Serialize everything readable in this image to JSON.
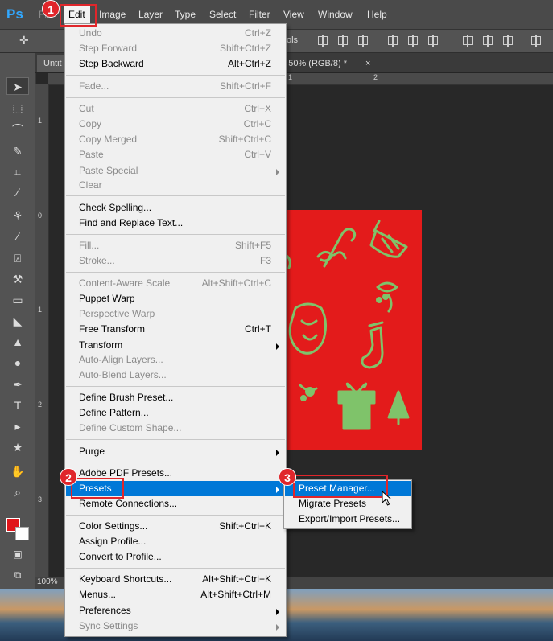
{
  "app": {
    "logo": "Ps"
  },
  "menubar": {
    "items": [
      "File",
      "Edit",
      "Image",
      "Layer",
      "Type",
      "Select",
      "Filter",
      "View",
      "Window",
      "Help"
    ],
    "active": "Edit"
  },
  "options": {
    "partial_label": "ols"
  },
  "document": {
    "tab_label": "Untit",
    "tab2_label": "@ 50% (RGB/8) *",
    "tab_close": "×",
    "zoom": "100%",
    "ruler_top": [
      "1",
      "2"
    ],
    "ruler_left": [
      "1",
      "0",
      "1",
      "2",
      "3"
    ]
  },
  "edit_menu": {
    "items": [
      {
        "label": "Undo",
        "shortcut": "Ctrl+Z",
        "disabled": true
      },
      {
        "label": "Step Forward",
        "shortcut": "Shift+Ctrl+Z",
        "disabled": true
      },
      {
        "label": "Step Backward",
        "shortcut": "Alt+Ctrl+Z",
        "disabled": false
      },
      {
        "label": "Fade...",
        "shortcut": "Shift+Ctrl+F",
        "disabled": true
      },
      {
        "label": "Cut",
        "shortcut": "Ctrl+X",
        "disabled": true
      },
      {
        "label": "Copy",
        "shortcut": "Ctrl+C",
        "disabled": true
      },
      {
        "label": "Copy Merged",
        "shortcut": "Shift+Ctrl+C",
        "disabled": true
      },
      {
        "label": "Paste",
        "shortcut": "Ctrl+V",
        "disabled": true
      },
      {
        "label": "Paste Special",
        "shortcut": "",
        "disabled": true,
        "submenu": true
      },
      {
        "label": "Clear",
        "shortcut": "",
        "disabled": true
      },
      {
        "label": "Check Spelling...",
        "shortcut": "",
        "disabled": false
      },
      {
        "label": "Find and Replace Text...",
        "shortcut": "",
        "disabled": false
      },
      {
        "label": "Fill...",
        "shortcut": "Shift+F5",
        "disabled": true
      },
      {
        "label": "Stroke...",
        "shortcut": "F3",
        "disabled": true
      },
      {
        "label": "Content-Aware Scale",
        "shortcut": "Alt+Shift+Ctrl+C",
        "disabled": true
      },
      {
        "label": "Puppet Warp",
        "shortcut": "",
        "disabled": false
      },
      {
        "label": "Perspective Warp",
        "shortcut": "",
        "disabled": true
      },
      {
        "label": "Free Transform",
        "shortcut": "Ctrl+T",
        "disabled": false
      },
      {
        "label": "Transform",
        "shortcut": "",
        "disabled": false,
        "submenu": true
      },
      {
        "label": "Auto-Align Layers...",
        "shortcut": "",
        "disabled": true
      },
      {
        "label": "Auto-Blend Layers...",
        "shortcut": "",
        "disabled": true
      },
      {
        "label": "Define Brush Preset...",
        "shortcut": "",
        "disabled": false
      },
      {
        "label": "Define Pattern...",
        "shortcut": "",
        "disabled": false
      },
      {
        "label": "Define Custom Shape...",
        "shortcut": "",
        "disabled": true
      },
      {
        "label": "Purge",
        "shortcut": "",
        "disabled": false,
        "submenu": true
      },
      {
        "label": "Adobe PDF Presets...",
        "shortcut": "",
        "disabled": false
      },
      {
        "label": "Presets",
        "shortcut": "",
        "disabled": false,
        "submenu": true,
        "highlighted": true
      },
      {
        "label": "Remote Connections...",
        "shortcut": "",
        "disabled": false
      },
      {
        "label": "Color Settings...",
        "shortcut": "Shift+Ctrl+K",
        "disabled": false
      },
      {
        "label": "Assign Profile...",
        "shortcut": "",
        "disabled": false
      },
      {
        "label": "Convert to Profile...",
        "shortcut": "",
        "disabled": false
      },
      {
        "label": "Keyboard Shortcuts...",
        "shortcut": "Alt+Shift+Ctrl+K",
        "disabled": false
      },
      {
        "label": "Menus...",
        "shortcut": "Alt+Shift+Ctrl+M",
        "disabled": false
      },
      {
        "label": "Preferences",
        "shortcut": "",
        "disabled": false,
        "submenu": true
      },
      {
        "label": "Sync Settings",
        "shortcut": "",
        "disabled": true,
        "submenu": true
      }
    ]
  },
  "presets_submenu": {
    "items": [
      {
        "label": "Preset Manager...",
        "highlighted": true
      },
      {
        "label": "Migrate Presets",
        "highlighted": false
      },
      {
        "label": "Export/Import Presets...",
        "highlighted": false
      }
    ]
  },
  "callouts": [
    {
      "number": "1"
    },
    {
      "number": "2"
    },
    {
      "number": "3"
    }
  ],
  "colors": {
    "highlight": "#0078d7",
    "callout": "#e0262b",
    "card_red": "#e31b1b",
    "ornament_green": "#7fc36a"
  }
}
